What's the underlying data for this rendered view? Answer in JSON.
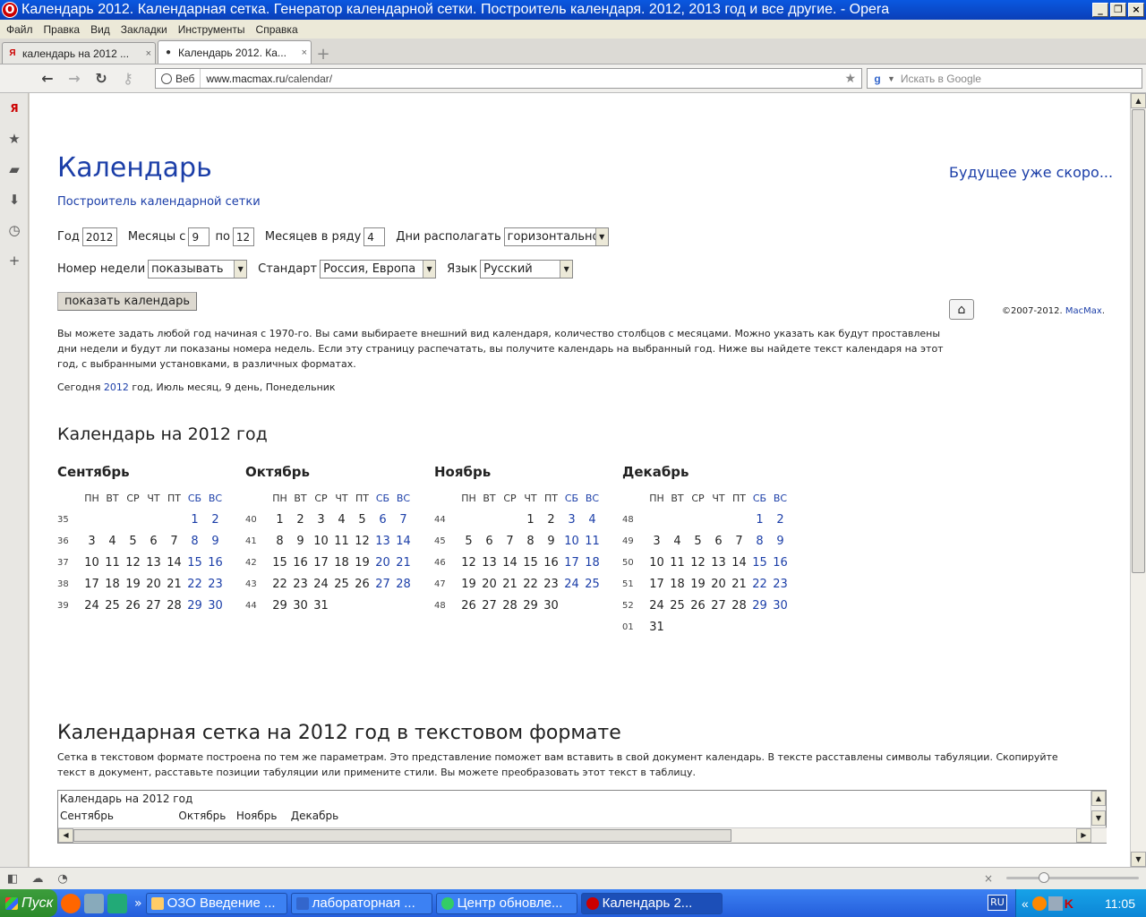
{
  "window": {
    "title": "Календарь 2012. Календарная сетка. Генератор календарной сетки. Построитель календаря. 2012, 2013 год и все другие. - Opera"
  },
  "menu": [
    "Файл",
    "Правка",
    "Вид",
    "Закладки",
    "Инструменты",
    "Справка"
  ],
  "tabs": [
    {
      "label": "календарь на 2012 ...",
      "active": false
    },
    {
      "label": "Календарь 2012. Ка...",
      "active": true
    }
  ],
  "address": {
    "badge": "Веб",
    "host": "www.macmax.ru",
    "path": "/calendar/",
    "search_placeholder": "Искать в Google"
  },
  "page": {
    "title": "Календарь",
    "subtitle": "Построитель календарной сетки",
    "future_link": "Будущее уже скоро...",
    "form": {
      "year_label": "Год",
      "year_value": "2012",
      "months_from_label": "Месяцы с",
      "months_from_value": "9",
      "months_to_label": "по",
      "months_to_value": "12",
      "per_row_label": "Месяцев в ряду",
      "per_row_value": "4",
      "days_label": "Дни располагать",
      "days_value": "горизонтально",
      "week_label": "Номер недели",
      "week_value": "показывать",
      "standard_label": "Стандарт",
      "standard_value": "Россия, Европа",
      "lang_label": "Язык",
      "lang_value": "Русский",
      "submit": "показать календарь"
    },
    "copyright_prefix": "©2007-2012. ",
    "copyright_link": "MacMax",
    "copyright_suffix": ".",
    "description": "Вы можете задать любой год начиная с 1970-го. Вы сами выбираете внешний вид календаря, количество столбцов с месяцами. Можно указать как будут проставлены дни недели и будут ли показаны номера недель. Если эту страницу распечатать, вы получите календарь на выбранный год. Ниже вы найдете текст календаря на этот год, с выбранными установками, в различных форматах.",
    "today_prefix": "Сегодня ",
    "today_year": "2012",
    "today_suffix": " год, Июль месяц, 9 день, Понедельник",
    "calendar_title": "Календарь на 2012 год",
    "weekdays": [
      "ПН",
      "ВТ",
      "СР",
      "ЧТ",
      "ПТ",
      "СБ",
      "ВС"
    ],
    "months": [
      {
        "name": "Сентябрь",
        "weeks": [
          {
            "n": "35",
            "d": [
              "",
              "",
              "",
              "",
              "",
              "1",
              "2"
            ]
          },
          {
            "n": "36",
            "d": [
              "3",
              "4",
              "5",
              "6",
              "7",
              "8",
              "9"
            ]
          },
          {
            "n": "37",
            "d": [
              "10",
              "11",
              "12",
              "13",
              "14",
              "15",
              "16"
            ]
          },
          {
            "n": "38",
            "d": [
              "17",
              "18",
              "19",
              "20",
              "21",
              "22",
              "23"
            ]
          },
          {
            "n": "39",
            "d": [
              "24",
              "25",
              "26",
              "27",
              "28",
              "29",
              "30"
            ]
          }
        ]
      },
      {
        "name": "Октябрь",
        "weeks": [
          {
            "n": "40",
            "d": [
              "1",
              "2",
              "3",
              "4",
              "5",
              "6",
              "7"
            ]
          },
          {
            "n": "41",
            "d": [
              "8",
              "9",
              "10",
              "11",
              "12",
              "13",
              "14"
            ]
          },
          {
            "n": "42",
            "d": [
              "15",
              "16",
              "17",
              "18",
              "19",
              "20",
              "21"
            ]
          },
          {
            "n": "43",
            "d": [
              "22",
              "23",
              "24",
              "25",
              "26",
              "27",
              "28"
            ]
          },
          {
            "n": "44",
            "d": [
              "29",
              "30",
              "31",
              "",
              "",
              "",
              ""
            ]
          }
        ]
      },
      {
        "name": "Ноябрь",
        "weeks": [
          {
            "n": "44",
            "d": [
              "",
              "",
              "",
              "1",
              "2",
              "3",
              "4"
            ]
          },
          {
            "n": "45",
            "d": [
              "5",
              "6",
              "7",
              "8",
              "9",
              "10",
              "11"
            ]
          },
          {
            "n": "46",
            "d": [
              "12",
              "13",
              "14",
              "15",
              "16",
              "17",
              "18"
            ]
          },
          {
            "n": "47",
            "d": [
              "19",
              "20",
              "21",
              "22",
              "23",
              "24",
              "25"
            ]
          },
          {
            "n": "48",
            "d": [
              "26",
              "27",
              "28",
              "29",
              "30",
              "",
              ""
            ]
          }
        ]
      },
      {
        "name": "Декабрь",
        "weeks": [
          {
            "n": "48",
            "d": [
              "",
              "",
              "",
              "",
              "",
              "1",
              "2"
            ]
          },
          {
            "n": "49",
            "d": [
              "3",
              "4",
              "5",
              "6",
              "7",
              "8",
              "9"
            ]
          },
          {
            "n": "50",
            "d": [
              "10",
              "11",
              "12",
              "13",
              "14",
              "15",
              "16"
            ]
          },
          {
            "n": "51",
            "d": [
              "17",
              "18",
              "19",
              "20",
              "21",
              "22",
              "23"
            ]
          },
          {
            "n": "52",
            "d": [
              "24",
              "25",
              "26",
              "27",
              "28",
              "29",
              "30"
            ]
          },
          {
            "n": "01",
            "d": [
              "31",
              "",
              "",
              "",
              "",
              "",
              ""
            ]
          }
        ]
      }
    ],
    "grid_title": "Календарная сетка на 2012 год в текстовом формате",
    "grid_description": "Сетка в текстовом формате построена по тем же параметрам. Это представление поможет вам вставить в свой документ календарь. В тексте расставлены символы табуляции. Скопируйте текст в документ, расставьте позиции табуляции или примените стили. Вы можете преобразовать этот текст в таблицу.",
    "text_lines": [
      "Календарь на 2012 год",
      "Сентябрь                   Октябрь   Ноябрь    Декабрь"
    ]
  },
  "taskbar": {
    "start": "Пуск",
    "tasks": [
      {
        "label": "ОЗО Введение ...",
        "active": false
      },
      {
        "label": "лабораторная ...",
        "active": false
      },
      {
        "label": "Центр обновле...",
        "active": false
      },
      {
        "label": "Календарь 2...",
        "active": true
      }
    ],
    "lang": "RU",
    "chevron": "«",
    "clock": "11:05"
  },
  "colors": {
    "link": "#1b3ea8",
    "weekend": "#1b3ea8",
    "titlebar": "#0a4ccc",
    "taskbar": "#245edb"
  }
}
